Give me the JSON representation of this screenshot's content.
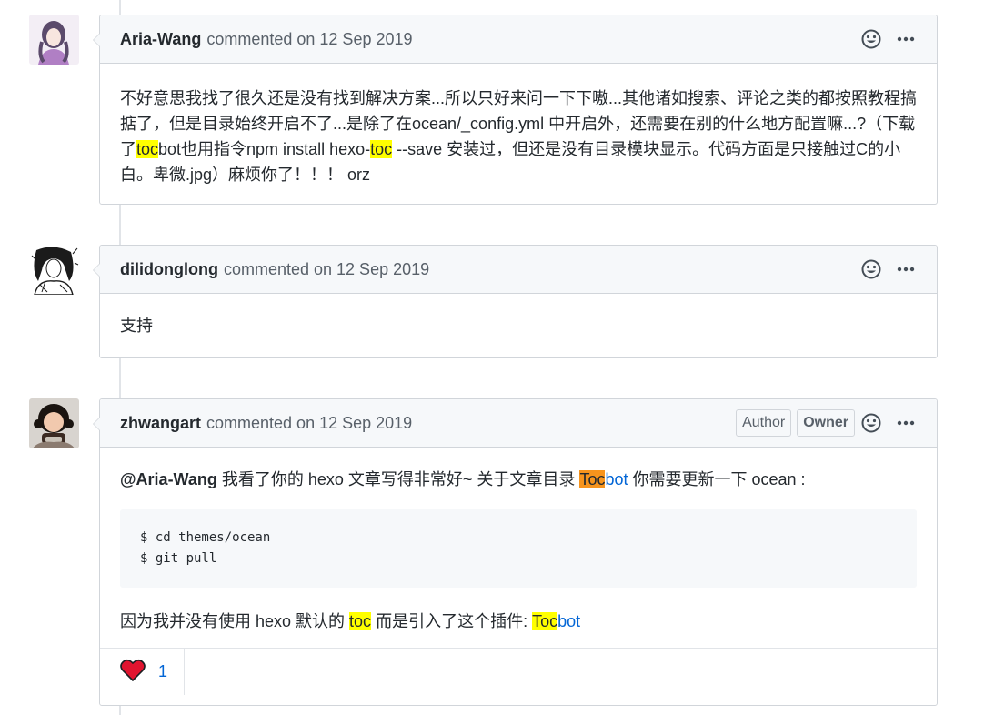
{
  "comments": [
    {
      "author": "Aria-Wang",
      "meta": "commented on 12 Sep 2019",
      "avatar": "avatar-illustration-purple",
      "body_parts": [
        {
          "t": "不好意思我找了很久还是没有找到解决方案...所以只好来问一下下嗷...其他诸如搜索、评论之类的都按照教程搞掂了，但是目录始终开启不了...是除了在ocean/_config.yml 中开启外，还需要在别的什么地方配置嘛...?（下载了"
        },
        {
          "t": "toc",
          "hl": true
        },
        {
          "t": "bot也用指令npm install hexo-"
        },
        {
          "t": "toc",
          "hl": true
        },
        {
          "t": " --save 安装过，但还是没有目录模块显示。代码方面是只接触过C的小白。卑微.jpg）麻烦你了！！！ orz"
        }
      ]
    },
    {
      "author": "dilidonglong",
      "meta": "commented on 12 Sep 2019",
      "avatar": "avatar-illustration-ink",
      "body": "支持"
    },
    {
      "author": "zhwangart",
      "meta": "commented on 12 Sep 2019",
      "avatar": "avatar-photo-child",
      "badges": [
        "Author",
        "Owner"
      ],
      "line1": {
        "mention": "@Aria-Wang",
        "text1": " 我看了你的 hexo 文章写得非常好~ 关于文章目录 ",
        "link_hl": "Toc",
        "link_rest": "bot",
        "text2": " 你需要更新一下 ocean :"
      },
      "code_lines": [
        "$ cd themes/ocean",
        "$ git pull"
      ],
      "line2": {
        "text1": "因为我并没有使用 hexo 默认的 ",
        "hl_word": "toc",
        "text2": " 而是引入了这个插件: ",
        "link_hl": "Toc",
        "link_rest": "bot"
      },
      "reactions": [
        {
          "icon": "heart-icon",
          "count": "1"
        }
      ]
    }
  ]
}
